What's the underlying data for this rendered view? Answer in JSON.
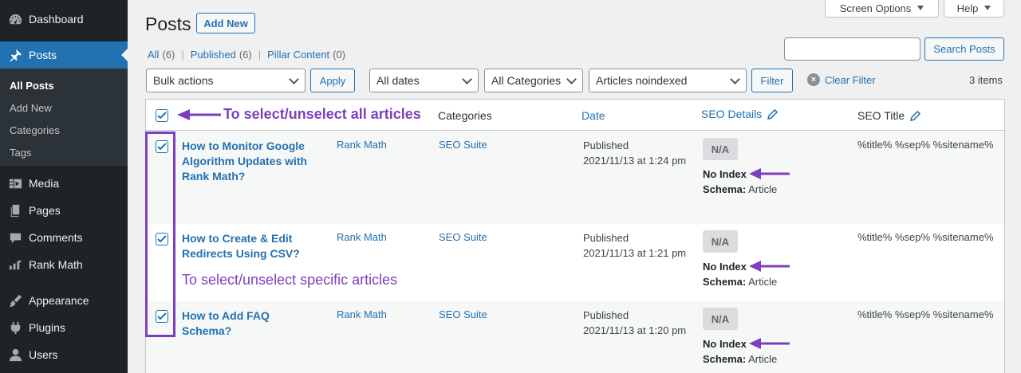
{
  "sidebar": {
    "dashboard": "Dashboard",
    "posts": "Posts",
    "submenu": [
      "All Posts",
      "Add New",
      "Categories",
      "Tags"
    ],
    "media": "Media",
    "pages": "Pages",
    "comments": "Comments",
    "rankmath": "Rank Math",
    "appearance": "Appearance",
    "plugins": "Plugins",
    "users": "Users"
  },
  "header": {
    "title": "Posts",
    "add_new": "Add New",
    "screen_options": "Screen Options",
    "help": "Help"
  },
  "views": {
    "all_label": "All",
    "all_count": "(6)",
    "published_label": "Published",
    "published_count": "(6)",
    "pillar_label": "Pillar Content",
    "pillar_count": "(0)",
    "separator": "|"
  },
  "search": {
    "value": "",
    "button": "Search Posts"
  },
  "filters": {
    "bulk_actions": "Bulk actions",
    "apply": "Apply",
    "dates": "All dates",
    "categories": "All Categories",
    "noindex": "Articles noindexed",
    "filter": "Filter",
    "clear_filter": "Clear Filter",
    "items_count": "3 items"
  },
  "table": {
    "headers": {
      "categories": "Categories",
      "date": "Date",
      "seo_details": "SEO Details",
      "seo_title": "SEO Title"
    },
    "rows": [
      {
        "title": "How to Monitor Google Algorithm Updates with Rank Math?",
        "author": "Rank Math",
        "category": "SEO Suite",
        "status": "Published",
        "date": "2021/11/13 at 1:24 pm",
        "badge": "N/A",
        "index_label": "No Index",
        "schema_label": "Schema:",
        "schema_value": "Article",
        "seo_title": "%title% %sep% %sitename%"
      },
      {
        "title": "How to Create & Edit Redirects Using CSV?",
        "author": "Rank Math",
        "category": "SEO Suite",
        "status": "Published",
        "date": "2021/11/13 at 1:21 pm",
        "badge": "N/A",
        "index_label": "No Index",
        "schema_label": "Schema:",
        "schema_value": "Article",
        "seo_title": "%title% %sep% %sitename%"
      },
      {
        "title": "How to Add FAQ Schema?",
        "author": "Rank Math",
        "category": "SEO Suite",
        "status": "Published",
        "date": "2021/11/13 at 1:20 pm",
        "badge": "N/A",
        "index_label": "No Index",
        "schema_label": "Schema:",
        "schema_value": "Article",
        "seo_title": "%title% %sep% %sitename%"
      }
    ]
  },
  "annotations": {
    "select_all": "To select/unselect all articles",
    "select_specific": "To select/unselect specific articles"
  },
  "colors": {
    "accent": "#2271b1",
    "sidebar_bg": "#1d2327",
    "annotation": "#7c3fbf"
  }
}
